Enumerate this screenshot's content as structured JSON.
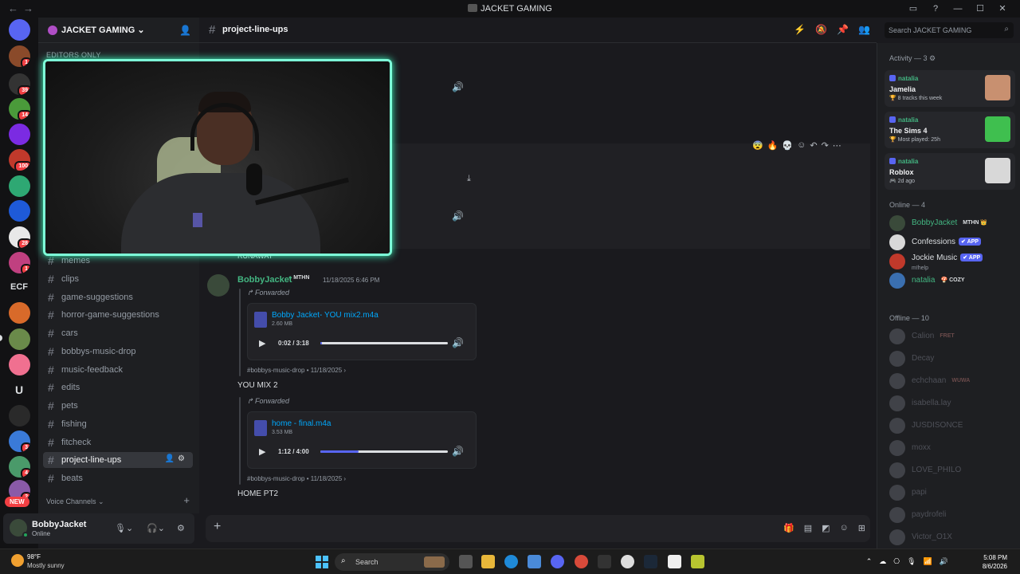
{
  "window": {
    "title": "JACKET GAMING",
    "nav_back": "←",
    "nav_forward": "→"
  },
  "rail": {
    "badges": [
      "1",
      "39",
      "14",
      "100",
      "28",
      "1",
      "3",
      "4",
      "2"
    ],
    "ecf_label": "ECF",
    "u_label": "U",
    "new_label": "NEW"
  },
  "server": {
    "name": "JACKET GAMING ⌄",
    "category_top": "EDITORS ONLY"
  },
  "channels": [
    {
      "name": "memes"
    },
    {
      "name": "clips"
    },
    {
      "name": "game-suggestions"
    },
    {
      "name": "horror-game-suggestions"
    },
    {
      "name": "cars"
    },
    {
      "name": "bobbys-music-drop"
    },
    {
      "name": "music-feedback"
    },
    {
      "name": "edits"
    },
    {
      "name": "pets"
    },
    {
      "name": "fishing"
    },
    {
      "name": "fitcheck"
    },
    {
      "name": "project-line-ups",
      "active": true
    },
    {
      "name": "beats"
    }
  ],
  "voice_channels_label": "Voice Channels",
  "user_panel": {
    "name": "BobbyJacket",
    "status": "Online"
  },
  "chat": {
    "channel_name": "project-line-ups",
    "partial_text": "RUNAWAY",
    "reactions": [
      "😨",
      "🔥",
      "💀"
    ],
    "message": {
      "author": "BobbyJacket",
      "role_tag": "MTHN",
      "timestamp": "11/18/2025 6:46 PM",
      "forwards": [
        {
          "label": "Forwarded",
          "file_name": "Bobby Jacket- YOU mix2.m4a",
          "file_size": "2.60 MB",
          "time": "0:02 / 3:18",
          "progress": 0.01,
          "source": "#bobbys-music-drop • 11/18/2025  ›",
          "caption": "YOU MIX 2"
        },
        {
          "label": "Forwarded",
          "file_name": "home - final.m4a",
          "file_size": "3.53 MB",
          "time": "1:12 / 4:00",
          "progress": 0.3,
          "source": "#bobbys-music-drop • 11/18/2025  ›",
          "caption": "HOME PT2"
        }
      ]
    }
  },
  "search": {
    "placeholder": "Search JACKET GAMING"
  },
  "members": {
    "activity_header": "Activity — 3 ⚙",
    "activities": [
      {
        "user": "natalia",
        "game": "Jamelia",
        "detail": "🏆 8 tracks this week",
        "art_color": "#c89070"
      },
      {
        "user": "natalia",
        "game": "The Sims 4",
        "detail": "🏆 Most played: 25h",
        "art_color": "#3fbf4f"
      },
      {
        "user": "natalia",
        "game": "Roblox",
        "detail": "🎮 2d ago",
        "art_color": "#d8d8d8"
      }
    ],
    "online_header": "Online — 4",
    "online": [
      {
        "name": "BobbyJacket",
        "tag": "MTHN 👑",
        "tag_type": "plain",
        "sub": "",
        "color": "#43b581",
        "avatar": "#3a4a3a"
      },
      {
        "name": "Confessions",
        "tag": "✔ APP",
        "tag_type": "app",
        "sub": "",
        "color": "#dbdee1",
        "avatar": "#d8d8d8"
      },
      {
        "name": "Jockie Music",
        "tag": "✔ APP",
        "tag_type": "app",
        "sub": "m!help",
        "color": "#dbdee1",
        "avatar": "#c0392b"
      },
      {
        "name": "natalia",
        "tag": "🍄 COZY",
        "tag_type": "plain",
        "sub": "",
        "color": "#43b581",
        "avatar": "#3a6fb0"
      }
    ],
    "offline_header": "Offline — 10",
    "offline": [
      {
        "name": "Calion",
        "tag": "FRET"
      },
      {
        "name": "Decay",
        "tag": ""
      },
      {
        "name": "echchaan",
        "tag": "WUWA"
      },
      {
        "name": "isabella.lay",
        "tag": ""
      },
      {
        "name": "JUSDISONCE",
        "tag": ""
      },
      {
        "name": "moxx",
        "tag": ""
      },
      {
        "name": "LOVE_PHILO",
        "tag": ""
      },
      {
        "name": "papi",
        "tag": ""
      },
      {
        "name": "paydrofeli",
        "tag": ""
      },
      {
        "name": "Victor_O1X",
        "tag": ""
      }
    ]
  },
  "taskbar": {
    "weather_temp": "98°F",
    "weather_desc": "Mostly sunny",
    "search_label": "Search",
    "time": "5:08 PM",
    "date": "8/6/2026"
  }
}
